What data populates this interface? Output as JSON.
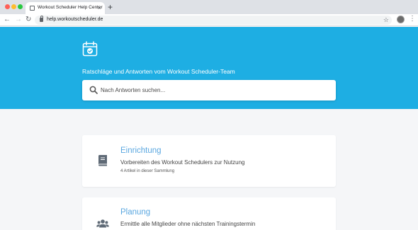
{
  "browser": {
    "tab_title": "Workout Scheduler Help Center",
    "tab_close": "×",
    "new_tab": "+",
    "url": "help.workoutscheduler.de",
    "nav": {
      "back": "←",
      "forward": "→",
      "reload": "↻"
    },
    "star": "☆",
    "menu": "⋮"
  },
  "hero": {
    "tagline": "Ratschläge und Antworten vom Workout Scheduler-Team",
    "search_placeholder": "Nach Antworten suchen...",
    "background_color": "#1eaee3"
  },
  "collections": [
    {
      "icon": "book-icon",
      "title": "Einrichtung",
      "description": "Vorbereiten des Workout Schedulers zur Nutzung",
      "meta": "4 Artikel in dieser Sammlung"
    },
    {
      "icon": "users-icon",
      "title": "Planung",
      "description": "Ermittle alle Mitglieder ohne nächsten Trainingstermin"
    }
  ],
  "colors": {
    "accent": "#5aa7e0",
    "page_bg": "#f5f6f8"
  }
}
